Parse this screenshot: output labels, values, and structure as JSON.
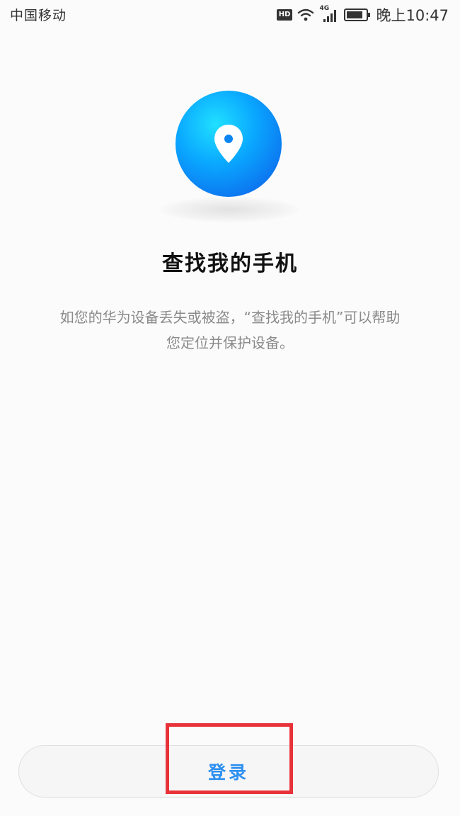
{
  "status_bar": {
    "carrier": "中国移动",
    "hd_label": "HD",
    "network_label": "4G",
    "time": "晚上10:47"
  },
  "hero": {
    "icon": "location-pin-icon",
    "colors": {
      "light": "#20e0ff",
      "dark": "#0d63e6"
    }
  },
  "title": "查找我的手机",
  "description": {
    "line1": "如您的华为设备丢失或被盗，“查找我的手机”可以帮助",
    "line2": "您定位并保护设备。"
  },
  "login_button": {
    "label": "登录",
    "color": "#2c8ff0"
  },
  "highlight": {
    "color": "#e8323a"
  }
}
